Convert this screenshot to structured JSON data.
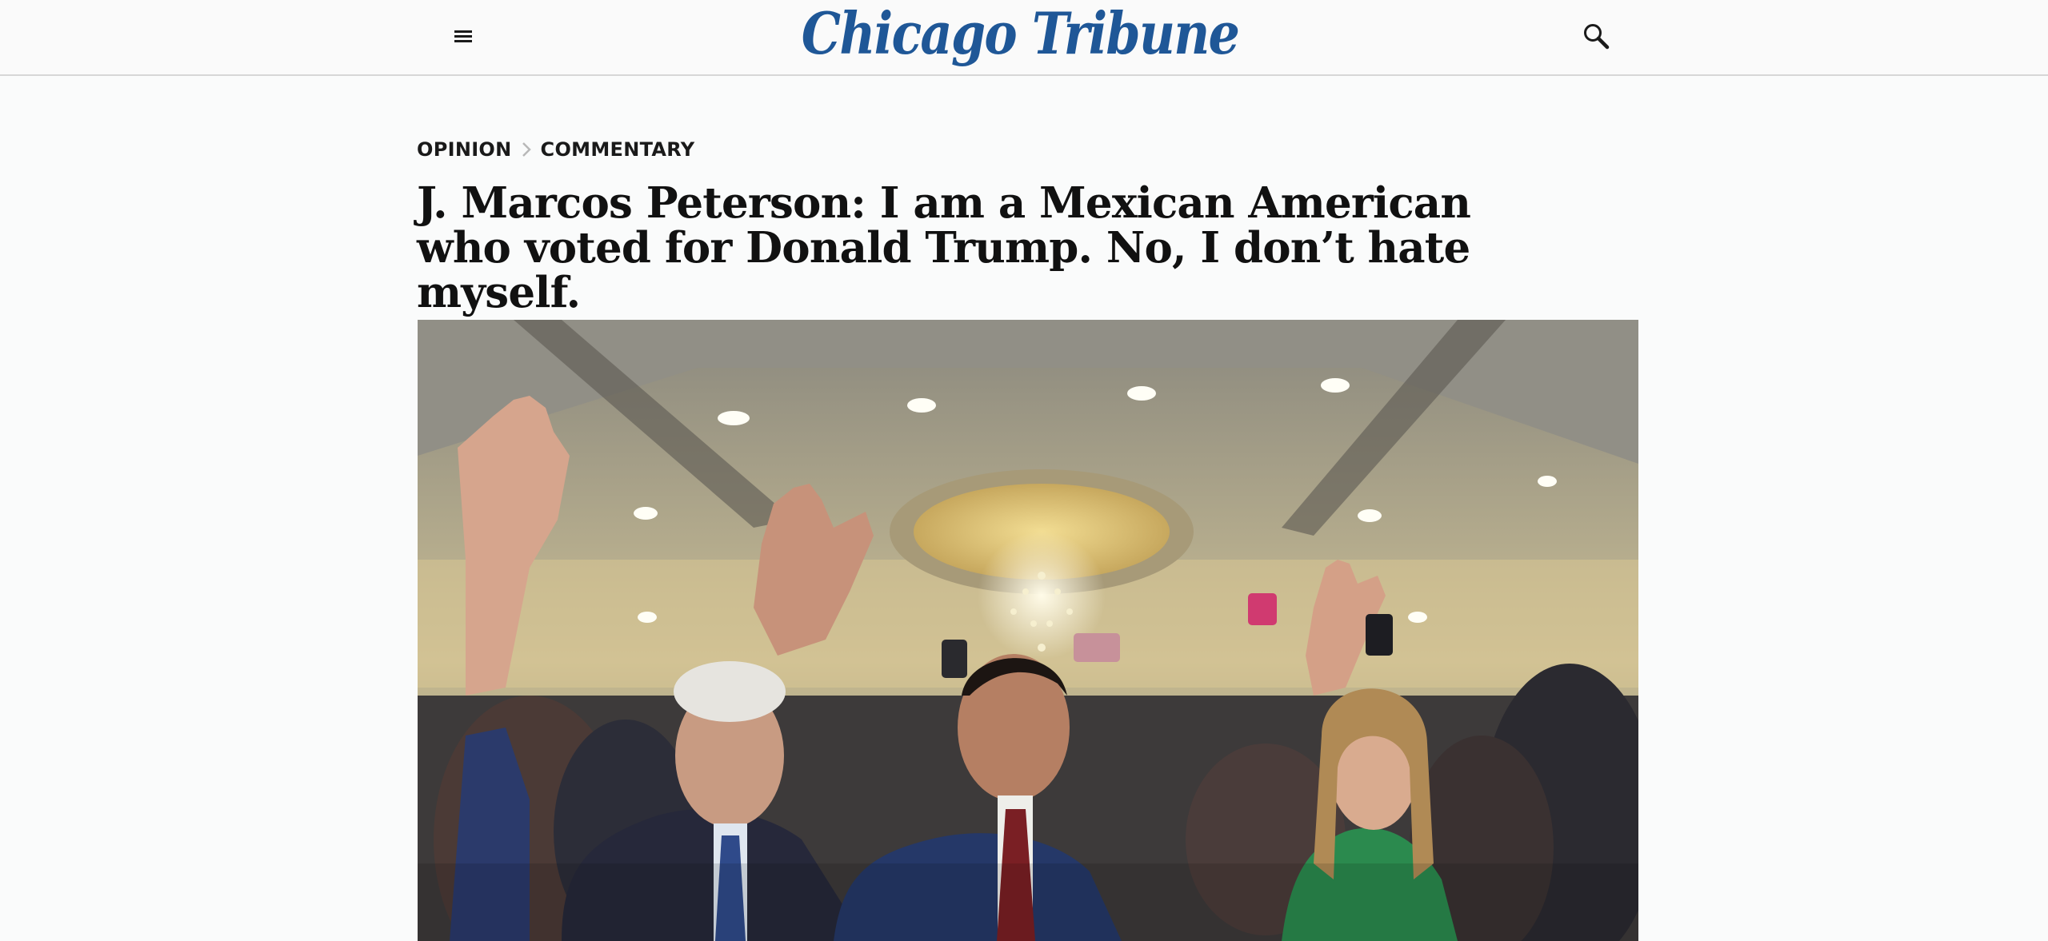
{
  "header": {
    "logo_text": "Chicago Tribune",
    "brand_color": "#1f5797",
    "menu_icon": "hamburger-menu-icon",
    "search_icon": "magnifier-search-icon"
  },
  "breadcrumb": {
    "section": "OPINION",
    "subsection": "COMMENTARY",
    "separator_icon": "chevron-right-icon"
  },
  "article": {
    "headline": "J. Marcos Peterson: I am a Mexican American who voted for Donald Trump. No, I don’t hate myself."
  }
}
